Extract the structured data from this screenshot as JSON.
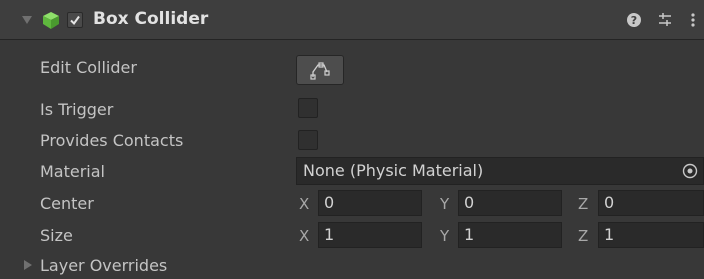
{
  "component": {
    "title": "Box Collider",
    "enabled": true,
    "colors": {
      "header_bg": "#3e3e3e",
      "body_bg": "#383838",
      "field_bg": "#2a2a2a",
      "icon_green": "#6fcf4a"
    }
  },
  "fields": {
    "edit_collider": {
      "label": "Edit Collider",
      "icon": "edit-bounds-icon"
    },
    "is_trigger": {
      "label": "Is Trigger",
      "checked": false
    },
    "provides_contacts": {
      "label": "Provides Contacts",
      "checked": false
    },
    "material": {
      "label": "Material",
      "value": "None (Physic Material)"
    },
    "center": {
      "label": "Center",
      "x": "0",
      "y": "0",
      "z": "0"
    },
    "size": {
      "label": "Size",
      "x": "1",
      "y": "1",
      "z": "1"
    }
  },
  "axes": {
    "x": "X",
    "y": "Y",
    "z": "Z"
  },
  "layer_overrides": {
    "label": "Layer Overrides",
    "expanded": false
  },
  "header_icons": [
    "help-icon",
    "presets-icon",
    "more-menu-icon"
  ]
}
